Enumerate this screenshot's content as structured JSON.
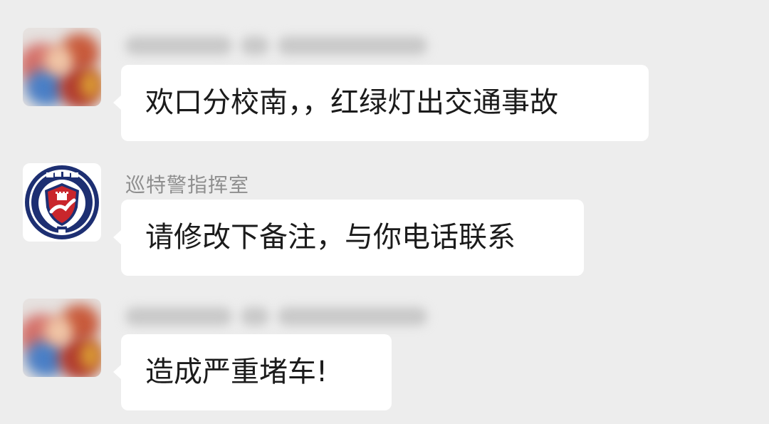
{
  "messages": [
    {
      "sender": "",
      "sender_blurred": true,
      "avatar": "blurred-cartoon-avatar",
      "text": "欢口分校南，，红绿灯出交通事故"
    },
    {
      "sender": "巡特警指挥室",
      "sender_blurred": false,
      "avatar": "police-emblem-avatar",
      "text": "请修改下备注，与你电话联系"
    },
    {
      "sender": "",
      "sender_blurred": true,
      "avatar": "blurred-cartoon-avatar",
      "text": "造成严重堵车!"
    }
  ],
  "colors": {
    "background": "#ededed",
    "bubble": "#ffffff",
    "sender_text": "#8e8e8e",
    "message_text": "#1b1b1b",
    "emblem_navy": "#1d2f72",
    "emblem_red": "#c9262c"
  }
}
